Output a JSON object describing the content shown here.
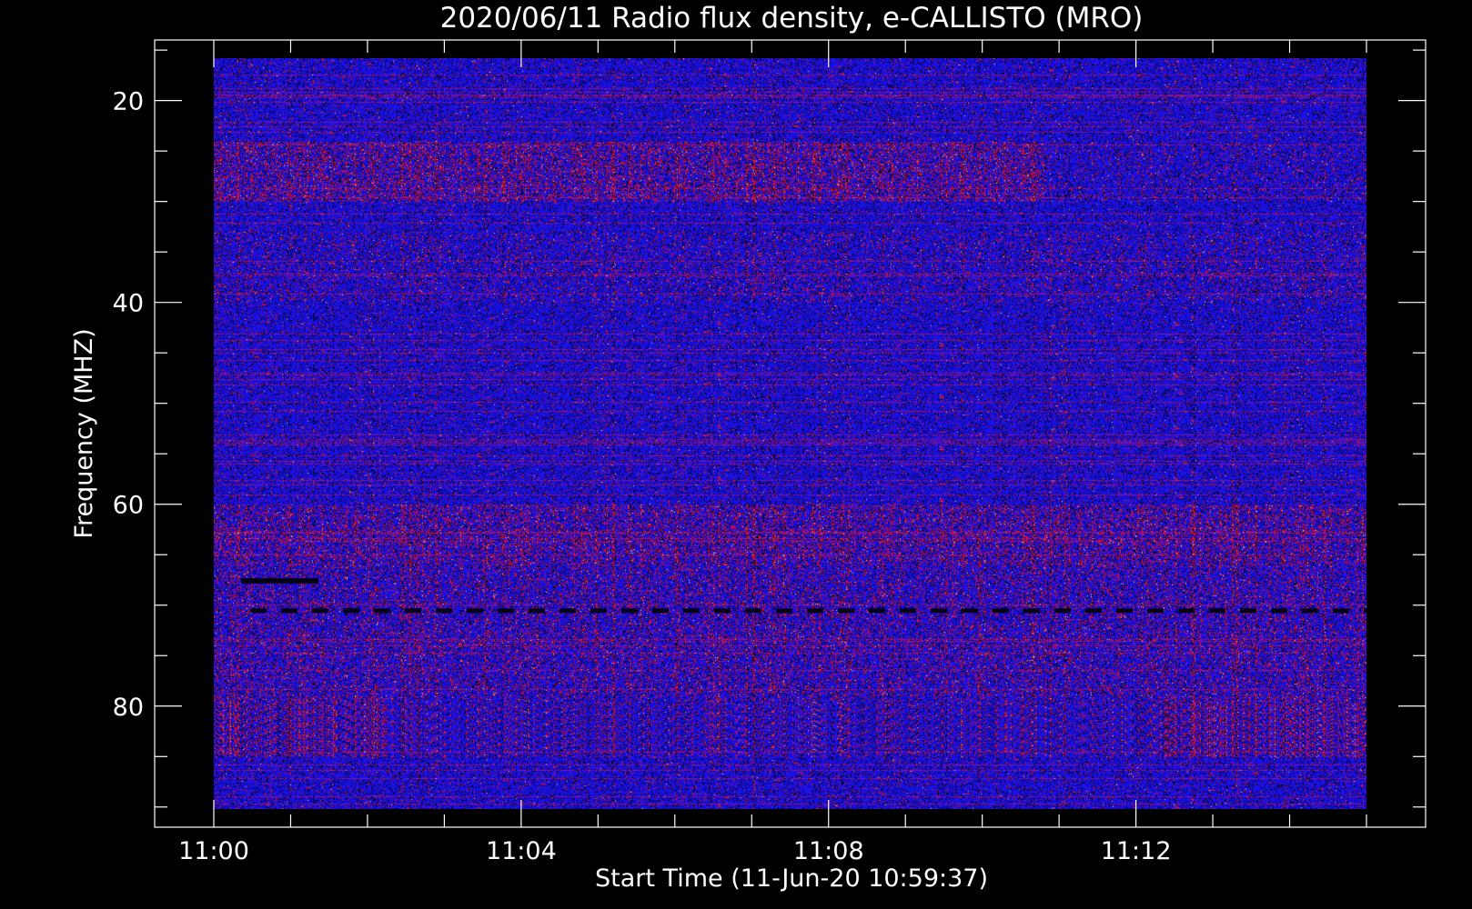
{
  "chart_data": {
    "type": "heatmap",
    "title": "2020/06/11  Radio flux density, e-CALLISTO (MRO)",
    "xlabel": "Start Time (11-Jun-20 10:59:37)",
    "ylabel": "Frequency (MHZ)",
    "x_range": [
      "11:00",
      "11:15"
    ],
    "ylim": [
      92,
      14
    ],
    "x_ticks": [
      "11:00",
      "11:04",
      "11:08",
      "11:12"
    ],
    "y_ticks": [
      20,
      40,
      60,
      80
    ],
    "y_axis_inverted": true,
    "grid": false,
    "colors": {
      "background": "#000000",
      "base": "#1a1aff",
      "enhanced": "#ff2a00",
      "bright": "#ffd080",
      "dark": "#000014"
    },
    "features": {
      "bright_band_top_mhz": [
        24,
        30
      ],
      "lower_emission_mhz": [
        60,
        85
      ],
      "dark_line_mhz": [
        70.5
      ],
      "data_start_offset_s": 23
    }
  }
}
